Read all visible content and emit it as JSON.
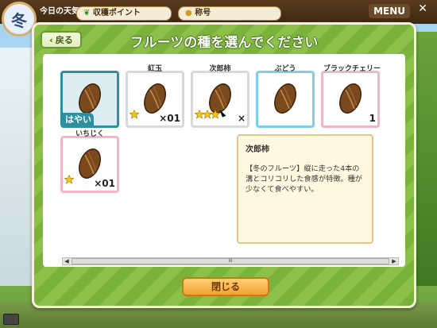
{
  "hud": {
    "season": "冬",
    "weather_label": "今日の天気",
    "harvest_points_label": "収穫ポイント",
    "title_label": "称号",
    "menu_label": "MENU",
    "close_glyph": "✕"
  },
  "dialog": {
    "back_label": "戻る",
    "title": "フルーツの種を選んでください",
    "close_button_label": "閉じる"
  },
  "seeds": [
    {
      "name": "",
      "badge": "はやい",
      "count": "",
      "stars": 0,
      "style": "selected"
    },
    {
      "name": "紅玉",
      "badge": "",
      "count": "×01",
      "stars": 1,
      "style": "normal"
    },
    {
      "name": "次郎柿",
      "badge": "",
      "count": "×",
      "stars": 3,
      "style": "normal"
    },
    {
      "name": "ぶどう",
      "badge": "",
      "count": "",
      "stars": 0,
      "style": "blue"
    },
    {
      "name": "ブラックチェリー",
      "badge": "",
      "count": "1",
      "stars": 0,
      "style": "pink"
    },
    {
      "name": "いちじく",
      "badge": "",
      "count": "×01",
      "stars": 1,
      "style": "pink"
    }
  ],
  "tooltip": {
    "title": "次郎柿",
    "description": "【冬のフルーツ】縦に走った4本の溝とコリコリした食感が特徴。種が少なくて食べやすい。"
  },
  "scrollbar": {
    "thumb_glyph": "III",
    "left_arrow": "◀",
    "right_arrow": "▶"
  },
  "colors": {
    "selected_border": "#2e8fa0",
    "blue_border": "#7fcde8",
    "pink_border": "#f0b6c6",
    "star": "#f5c518"
  }
}
